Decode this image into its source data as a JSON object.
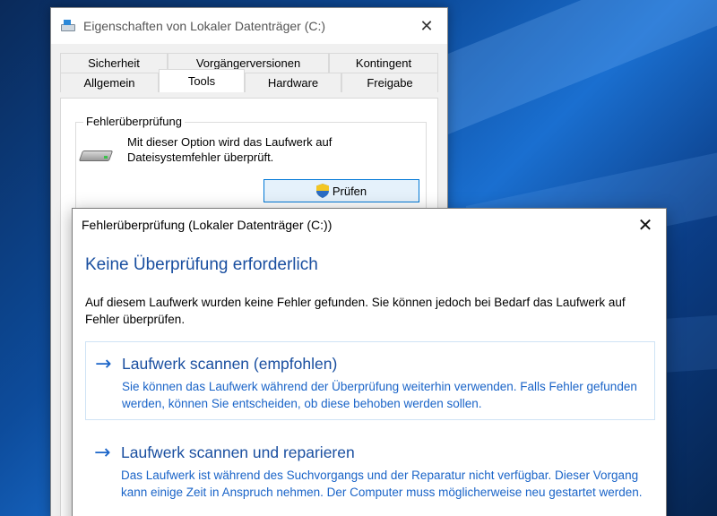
{
  "properties_window": {
    "title": "Eigenschaften von Lokaler Datenträger (C:)",
    "close_glyph": "✕",
    "tabs_row1": [
      "Sicherheit",
      "Vorgängerversionen",
      "Kontingent"
    ],
    "tabs_row2": [
      "Allgemein",
      "Tools",
      "Hardware",
      "Freigabe"
    ],
    "active_tab": "Tools",
    "group_label": "Fehlerüberprüfung",
    "description": "Mit dieser Option wird das Laufwerk auf Dateisystemfehler überprüft.",
    "check_button_label": "Prüfen"
  },
  "dialog": {
    "title": "Fehlerüberprüfung (Lokaler Datenträger (C:))",
    "close_glyph": "✕",
    "heading": "Keine Überprüfung erforderlich",
    "intro": "Auf diesem Laufwerk wurden keine Fehler gefunden. Sie können jedoch bei Bedarf das Laufwerk auf Fehler überprüfen.",
    "commands": [
      {
        "title": "Laufwerk scannen (empfohlen)",
        "description": "Sie können das Laufwerk während der Überprüfung weiterhin verwenden. Falls Fehler gefunden werden, können Sie entscheiden, ob diese behoben werden sollen."
      },
      {
        "title": "Laufwerk scannen und reparieren",
        "description": "Das Laufwerk ist während des Suchvorgangs und der Reparatur nicht verfügbar. Dieser Vorgang kann einige Zeit in Anspruch nehmen. Der Computer muss möglicherweise neu gestartet werden."
      }
    ],
    "arrow_glyph": "→"
  },
  "icons": {
    "drive": "drive-icon",
    "shield": "uac-shield-icon",
    "hdd": "hard-disk-icon"
  },
  "colors": {
    "accent": "#0078d7",
    "link_blue": "#1a64c8",
    "heading_blue": "#1a4fa0"
  }
}
